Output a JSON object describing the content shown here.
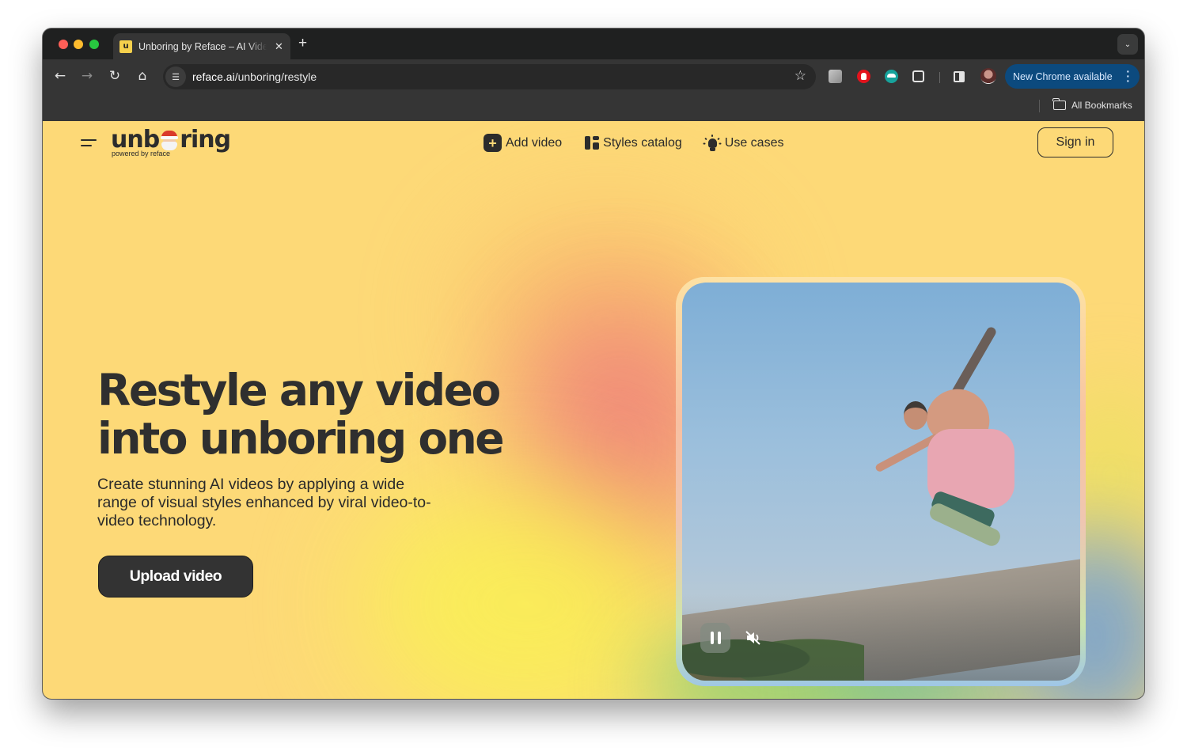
{
  "browser": {
    "tab": {
      "title": "Unboring by Reface – AI Video",
      "favicon_letter": "u"
    },
    "url": {
      "host": "reface.ai",
      "path": "/unboring/restyle"
    },
    "update_button": "New Chrome available",
    "bookmarks": {
      "all_bookmarks_label": "All Bookmarks"
    }
  },
  "header": {
    "logo": {
      "word_left": "unb",
      "word_right": "ring",
      "subtitle": "powered by reface"
    },
    "nav": [
      {
        "label": "Add video",
        "icon": "plus-square-icon"
      },
      {
        "label": "Styles catalog",
        "icon": "layout-grid-icon"
      },
      {
        "label": "Use cases",
        "icon": "lightbulb-icon"
      }
    ],
    "sign_in": "Sign in"
  },
  "hero": {
    "title_line1": "Restyle any video",
    "title_line2": "into unboring one",
    "subtitle": "Create stunning AI videos by applying a wide range of visual styles enhanced by viral video-to-video technology.",
    "cta": "Upload video"
  },
  "video": {
    "state": "playing",
    "muted": true
  },
  "colors": {
    "page_bg": "#fdd977",
    "text_dark": "#2f2f2f",
    "cta_bg": "#333333",
    "chrome_update_bg": "#0c4a7e"
  }
}
